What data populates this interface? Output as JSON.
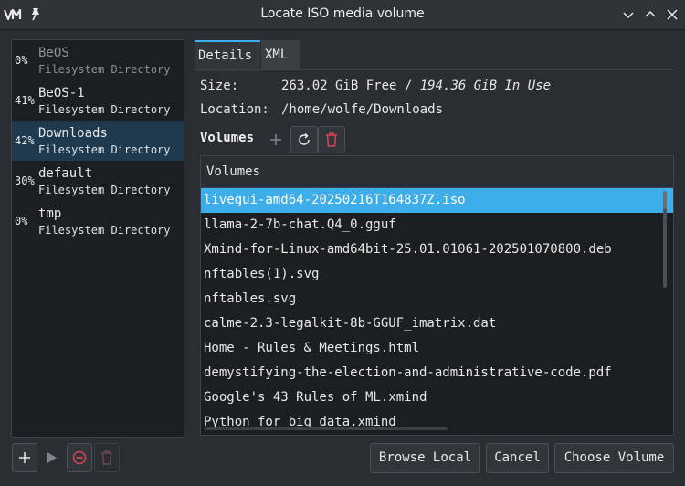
{
  "window": {
    "title": "Locate ISO media volume"
  },
  "filesystems": [
    {
      "percent": "0%",
      "name": "BeOS",
      "type": "Filesystem Directory",
      "dimmed": true
    },
    {
      "percent": "41%",
      "name": "BeOS-1",
      "type": "Filesystem Directory"
    },
    {
      "percent": "42%",
      "name": "Downloads",
      "type": "Filesystem Directory",
      "selected": true
    },
    {
      "percent": "30%",
      "name": "default",
      "type": "Filesystem Directory"
    },
    {
      "percent": "0%",
      "name": "tmp",
      "type": "Filesystem Directory"
    }
  ],
  "tabs": [
    {
      "label": "Details",
      "active": true
    },
    {
      "label": "XML"
    }
  ],
  "details": {
    "size_label": "Size:",
    "free": "263.02 GiB Free",
    "separator": "/",
    "in_use": "194.36 GiB In Use",
    "location_label": "Location:",
    "location": "/home/wolfe/Downloads"
  },
  "volumes": {
    "heading": "Volumes",
    "column_header": "Volumes",
    "items": [
      "livegui-amd64-20250216T164837Z.iso",
      "llama-2-7b-chat.Q4_0.gguf",
      "Xmind-for-Linux-amd64bit-25.01.01061-202501070800.deb",
      "nftables(1).svg",
      "nftables.svg",
      "calme-2.3-legalkit-8b-GGUF_imatrix.dat",
      "Home - Rules & Meetings.html",
      "demystifying-the-election-and-administrative-code.pdf",
      "Google's 43 Rules of ML.xmind",
      "Python for big data.xmind"
    ],
    "selected_index": 0
  },
  "buttons": {
    "browse_local": "Browse Local",
    "cancel": "Cancel",
    "choose_volume": "Choose Volume"
  },
  "colors": {
    "accent": "#3daee9",
    "selection_dark": "#1f3a4e",
    "danger": "#da4453",
    "background": "#2a2e32",
    "panel": "#1c1f22"
  },
  "icons": {
    "app": "app-logo-icon",
    "pin": "pin-icon",
    "minimize": "chevron-down-icon",
    "maximize": "chevron-up-icon",
    "close": "close-icon",
    "add": "plus-icon",
    "refresh": "refresh-icon",
    "delete": "trash-icon",
    "play": "play-icon",
    "stop": "stop-icon"
  }
}
